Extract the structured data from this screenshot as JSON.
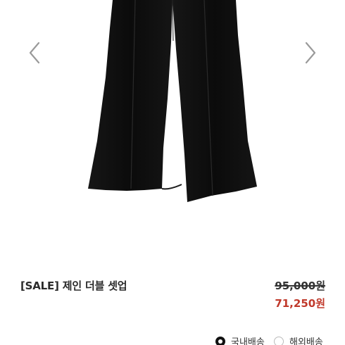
{
  "product": {
    "title": "[SALE] 제인 더블 셋업",
    "original_price": "95,000원",
    "sale_price": "71,250원"
  },
  "gallery": {
    "prev_icon": "chevron-left-icon",
    "next_icon": "chevron-right-icon"
  },
  "shipping": {
    "domestic_label": "국내배송",
    "overseas_label": "해외배송",
    "selected": "domestic"
  },
  "colors": {
    "sale_price": "#c0392b",
    "product_black": "#0e0e0e"
  }
}
